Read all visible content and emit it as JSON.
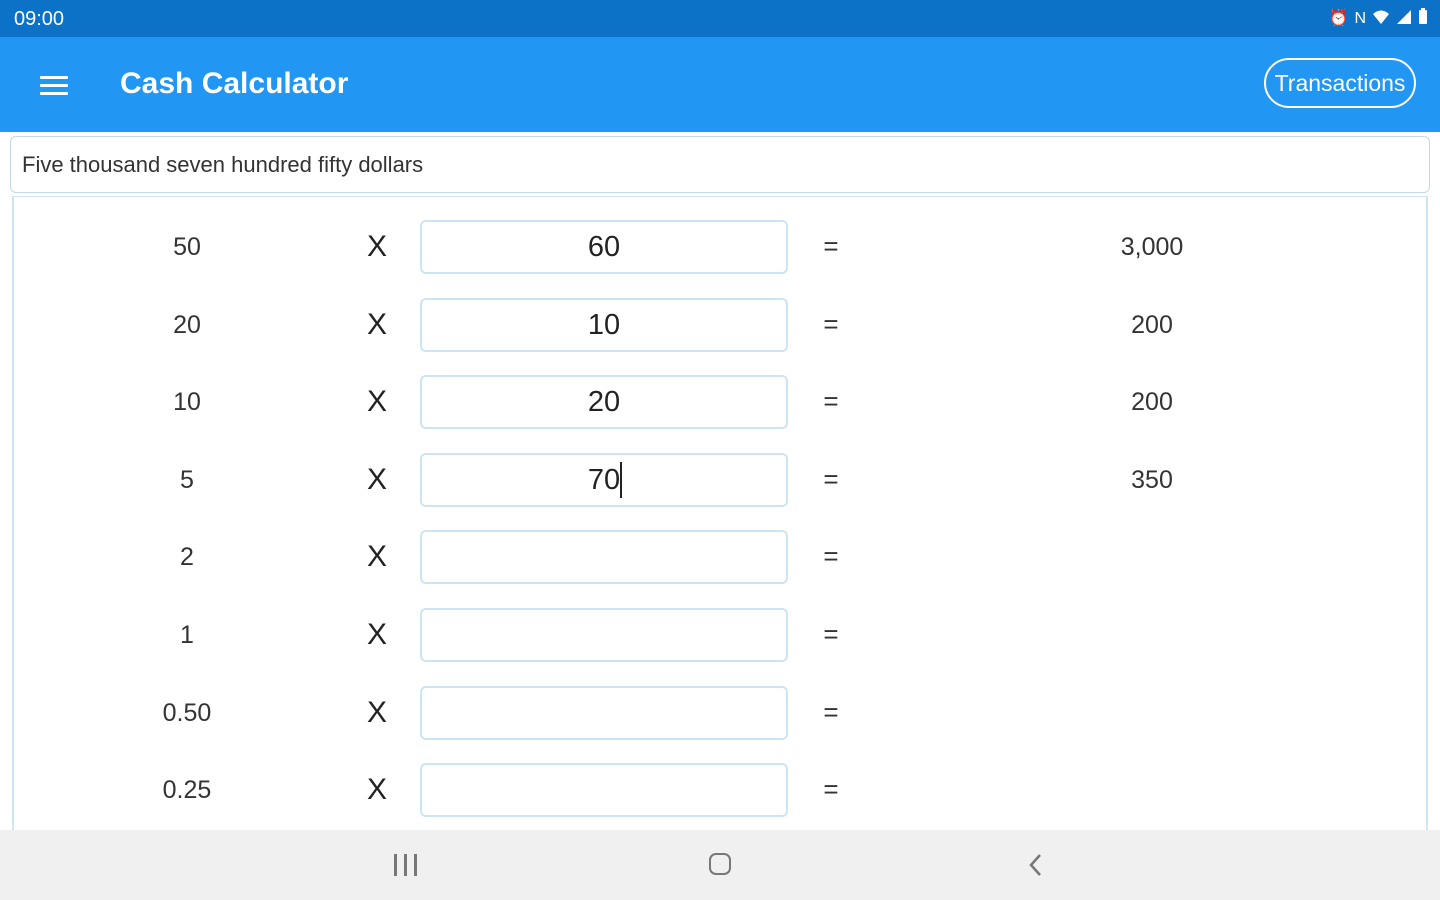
{
  "status_bar": {
    "time": "09:00",
    "icons": [
      "alarm-icon",
      "nfc-icon",
      "wifi-icon",
      "signal-icon",
      "battery-icon"
    ]
  },
  "app_bar": {
    "title": "Cash Calculator",
    "transactions_label": "Transactions",
    "menu_icon": "hamburger-menu-icon",
    "color": "#2196f3",
    "status_color": "#0b72c7"
  },
  "amount_in_words": "Five thousand seven hundred fifty dollars",
  "multiply_symbol": "X",
  "equals_symbol": "=",
  "rows": [
    {
      "denomination": "50",
      "quantity": "60",
      "total": "3,000"
    },
    {
      "denomination": "20",
      "quantity": "10",
      "total": "200"
    },
    {
      "denomination": "10",
      "quantity": "20",
      "total": "200"
    },
    {
      "denomination": "5",
      "quantity": "70",
      "total": "350"
    },
    {
      "denomination": "2",
      "quantity": "",
      "total": ""
    },
    {
      "denomination": "1",
      "quantity": "",
      "total": ""
    },
    {
      "denomination": "0.50",
      "quantity": "",
      "total": ""
    },
    {
      "denomination": "0.25",
      "quantity": "",
      "total": ""
    }
  ],
  "focused_row_index": 3,
  "nav_bar": {
    "icons": [
      "recent-apps-icon",
      "home-icon",
      "back-icon"
    ]
  }
}
